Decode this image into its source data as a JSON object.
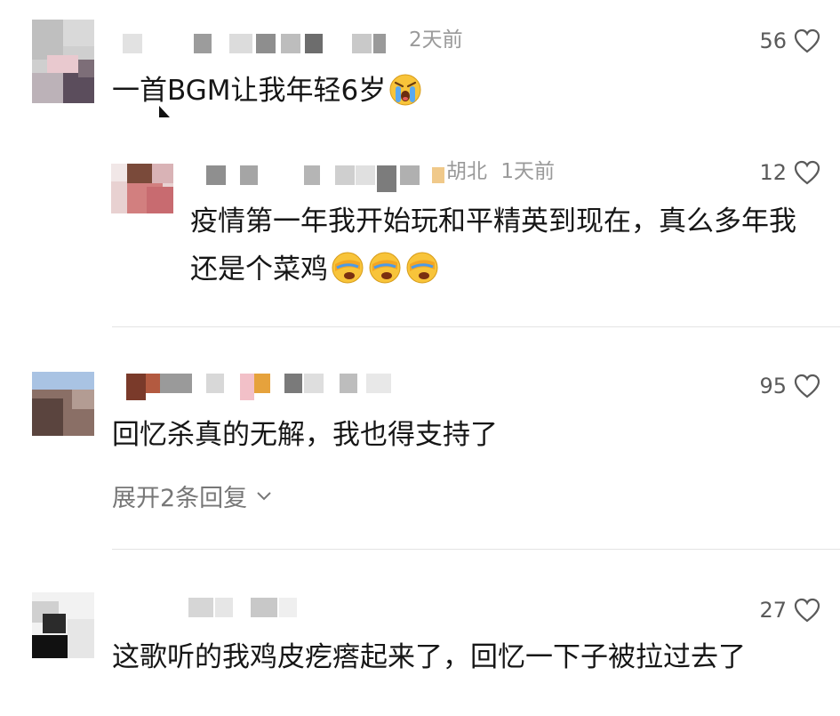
{
  "comments": [
    {
      "time": "2天前",
      "likes": "56",
      "text": "一首BGM让我年轻6岁",
      "emoji": "crying-face",
      "reply": {
        "location": "胡北",
        "time": "1天前",
        "likes": "12",
        "text": "疫情第一年我开始玩和平精英到现在，真么多年我还是个菜鸡",
        "emoji": "facepalm-crying-face"
      }
    },
    {
      "likes": "95",
      "text": "回忆杀真的无解，我也得支持了",
      "expand_label": "展开2条回复"
    },
    {
      "likes": "27",
      "text": "这歌听的我鸡皮疙瘩起来了，回忆一下子被拉过去了"
    }
  ],
  "colors": {
    "divider": "#e3e3e3",
    "meta": "#9a9a9a",
    "text": "#161616"
  }
}
